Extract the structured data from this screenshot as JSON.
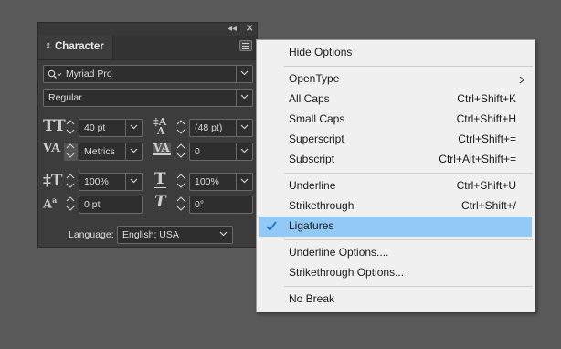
{
  "panel": {
    "title": "Character",
    "font_family": "Myriad Pro",
    "font_style": "Regular",
    "font_size": "40 pt",
    "leading": "(48 pt)",
    "kerning": "Metrics",
    "tracking": "0",
    "vertical_scale": "100%",
    "horizontal_scale": "100%",
    "baseline_shift": "0 pt",
    "skew": "0°",
    "language_label": "Language:",
    "language_value": "English: USA"
  },
  "menu": {
    "items": [
      {
        "label": "Hide Options",
        "shortcut": ""
      },
      {
        "label": "OpenType",
        "shortcut": ""
      },
      {
        "label": "All Caps",
        "shortcut": "Ctrl+Shift+K"
      },
      {
        "label": "Small Caps",
        "shortcut": "Ctrl+Shift+H"
      },
      {
        "label": "Superscript",
        "shortcut": "Ctrl+Shift+="
      },
      {
        "label": "Subscript",
        "shortcut": "Ctrl+Alt+Shift+="
      },
      {
        "label": "Underline",
        "shortcut": "Ctrl+Shift+U"
      },
      {
        "label": "Strikethrough",
        "shortcut": "Ctrl+Shift+/"
      },
      {
        "label": "Ligatures",
        "shortcut": ""
      },
      {
        "label": "Underline Options....",
        "shortcut": ""
      },
      {
        "label": "Strikethrough Options...",
        "shortcut": ""
      },
      {
        "label": "No Break",
        "shortcut": ""
      }
    ]
  },
  "icons": {
    "collapse": "double-chevron-left-icon",
    "close": "close-icon",
    "panel_menu": "hamburger-menu-icon",
    "checked": "checkmark-icon",
    "submenu": "chevron-right-icon"
  },
  "colors": {
    "background": "#595959",
    "panel": "#3c3c3c",
    "menu": "#f0f0f0",
    "highlight": "#91c9f7",
    "check": "#1e73be"
  }
}
